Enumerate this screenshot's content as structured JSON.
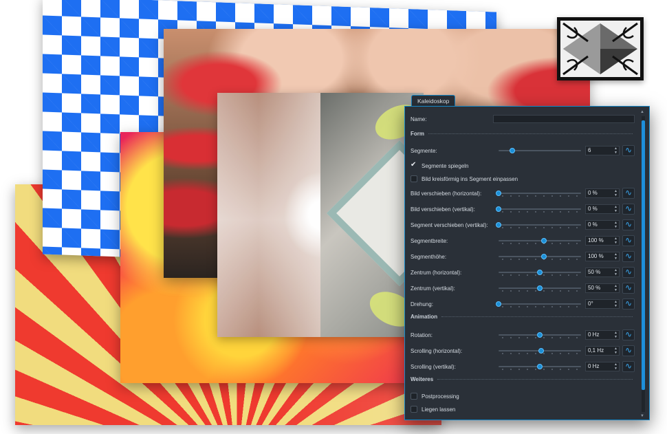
{
  "dialog": {
    "tab_title": "Kaleidoskop",
    "name_label": "Name:",
    "name_value": "",
    "sections": {
      "form": "Form",
      "animation": "Animation",
      "misc": "Weiteres"
    },
    "segmente": {
      "label": "Segmente:",
      "value": "6",
      "level": 0.17
    },
    "checkbox_segmente_spiegeln": {
      "label": "Segmente spiegeln",
      "checked": true
    },
    "checkbox_kreisfoermig": {
      "label": "Bild kreisförmig ins Segment einpassen",
      "checked": false
    },
    "params": [
      {
        "label": "Bild verschieben (horizontal):",
        "value": "0 %",
        "level": 0.0
      },
      {
        "label": "Bild verschieben (vertikal):",
        "value": "0 %",
        "level": 0.0
      },
      {
        "label": "Segment verschieben (vertikal):",
        "value": "0 %",
        "level": 0.0
      },
      {
        "label": "Segmentbreite:",
        "value": "100 %",
        "level": 0.55
      },
      {
        "label": "Segmenthöhe:",
        "value": "100 %",
        "level": 0.55
      },
      {
        "label": "Zentrum (horizontal):",
        "value": "50 %",
        "level": 0.5
      },
      {
        "label": "Zentrum (vertikal):",
        "value": "50 %",
        "level": 0.5
      },
      {
        "label": "Drehung:",
        "value": "0°",
        "level": 0.0
      }
    ],
    "animation_params": [
      {
        "label": "Rotation:",
        "value": "0 Hz",
        "level": 0.5
      },
      {
        "label": "Scrolling (horizontal):",
        "value": "0,1 Hz",
        "level": 0.52
      },
      {
        "label": "Scrolling (vertikal):",
        "value": "0 Hz",
        "level": 0.5
      }
    ],
    "checkbox_postprocessing": {
      "label": "Postprocessing",
      "checked": false
    },
    "checkbox_liegen_lassen": {
      "label": "Liegen lassen",
      "checked": false
    },
    "curve_icon": "curve-icon",
    "accent_color": "#1688c8"
  }
}
